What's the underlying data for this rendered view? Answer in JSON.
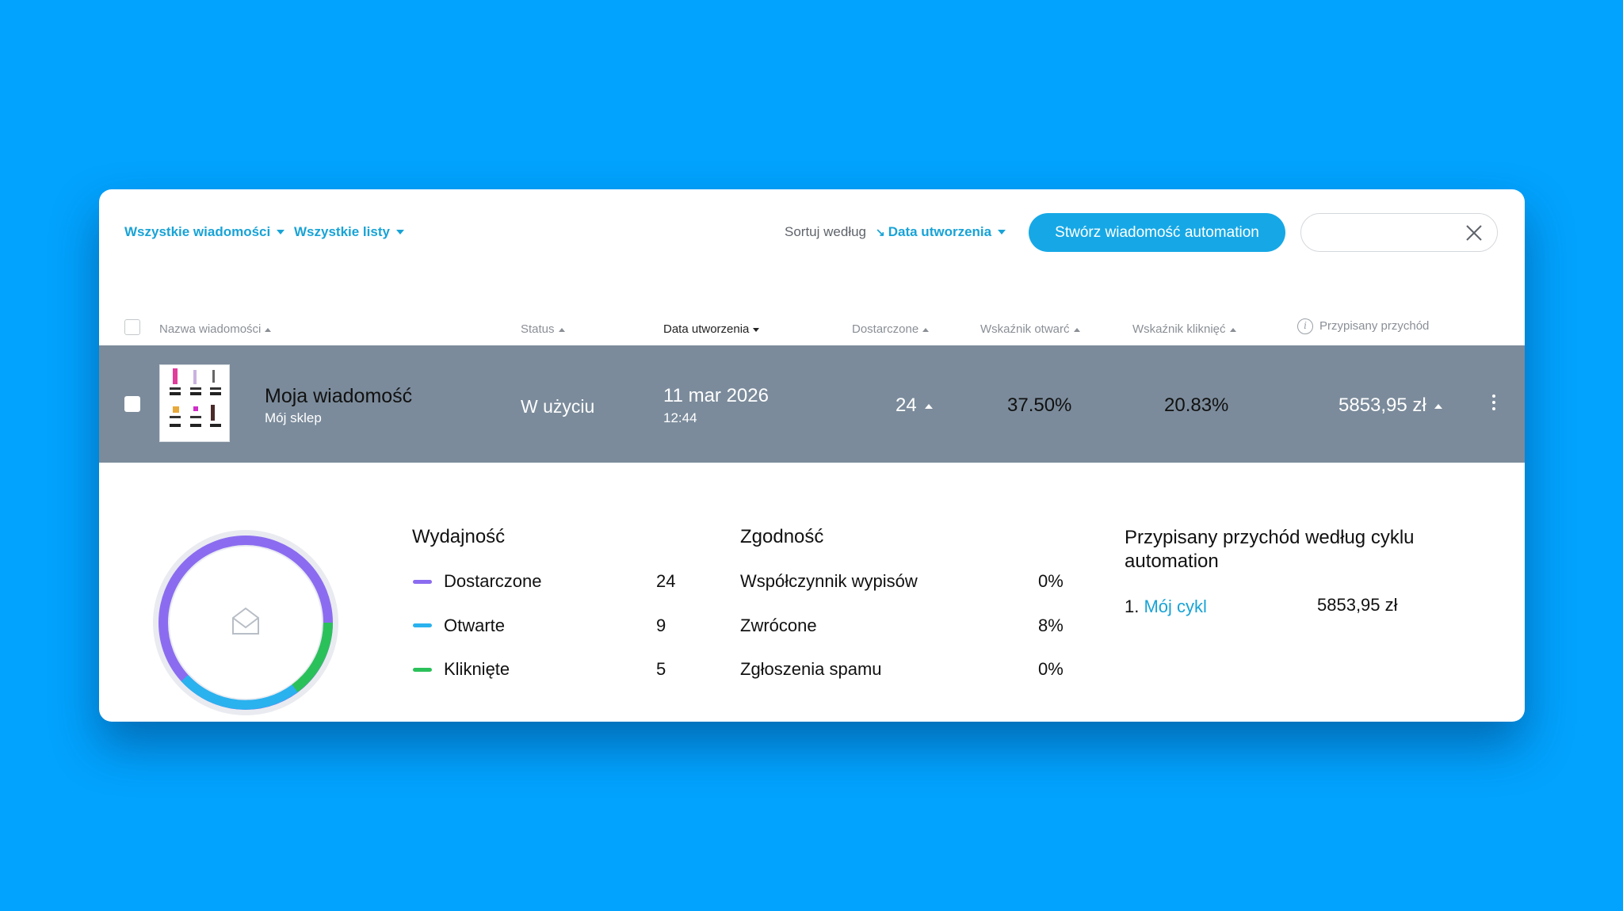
{
  "toolbar": {
    "filter_messages": "Wszystkie wiadomości",
    "filter_lists": "Wszystkie listy",
    "sort_label": "Sortuj według",
    "sort_value": "Data utworzenia",
    "create_button": "Stwórz wiadomość automation",
    "search_value": "",
    "search_placeholder": ""
  },
  "table": {
    "headers": {
      "name": "Nazwa wiadomości",
      "status": "Status",
      "created": "Data utworzenia",
      "delivered": "Dostarczone",
      "open_rate": "Wskaźnik otwarć",
      "click_rate": "Wskaźnik kliknięć",
      "revenue": "Przypisany przychód"
    },
    "row": {
      "name": "Moja wiadomość",
      "store": "Mój sklep",
      "status": "W użyciu",
      "date": "11 mar 2026",
      "time": "12:44",
      "delivered": "24",
      "open_rate": "37.50%",
      "click_rate": "20.83%",
      "revenue": "5853,95 zł"
    }
  },
  "details": {
    "performance": {
      "title": "Wydajność",
      "items": [
        {
          "label": "Dostarczone",
          "value": "24",
          "color": "#8b6cf0"
        },
        {
          "label": "Otwarte",
          "value": "9",
          "color": "#2ab2ee"
        },
        {
          "label": "Kliknięte",
          "value": "5",
          "color": "#2bc15a"
        }
      ]
    },
    "compliance": {
      "title": "Zgodność",
      "items": [
        {
          "label": "Współczynnik wypisów",
          "value": "0%"
        },
        {
          "label": "Zwrócone",
          "value": "8%"
        },
        {
          "label": "Zgłoszenia spamu",
          "value": "0%"
        }
      ]
    },
    "revenue": {
      "title": "Przypisany przychód według cyklu automation",
      "items": [
        {
          "index": "1.",
          "name": "Mój cykl",
          "value": "5853,95 zł"
        }
      ]
    }
  },
  "colors": {
    "background": "#02a3fe",
    "accent": "#16a8e6",
    "row_bg": "#7b8b9b"
  }
}
